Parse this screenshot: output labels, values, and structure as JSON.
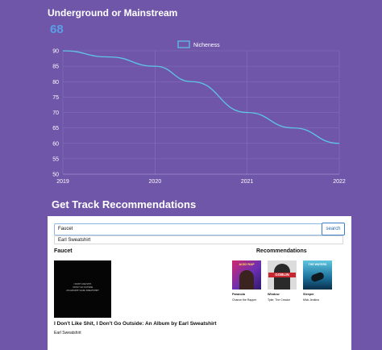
{
  "chart_section": {
    "title": "Underground or Mainstream",
    "score": "68"
  },
  "chart_data": {
    "type": "line",
    "title": "",
    "xlabel": "",
    "ylabel": "",
    "x": [
      "2019",
      "2020",
      "2021",
      "2022"
    ],
    "series": [
      {
        "name": "Nicheness",
        "x": [
          2019,
          2019.5,
          2020,
          2020.4,
          2021,
          2021.5,
          2022
        ],
        "values": [
          90,
          88,
          85,
          80,
          70,
          65,
          60
        ]
      }
    ],
    "ylim": [
      50,
      90
    ],
    "yticks": [
      "50",
      "55",
      "60",
      "65",
      "70",
      "75",
      "80",
      "85",
      "90"
    ],
    "grid": true,
    "legend": "top-center",
    "line_color": "#5ec6e6"
  },
  "recommendations_section": {
    "title": "Get Track Recommendations",
    "search_value": "Faucet",
    "search_button": "search",
    "suggestion": "Earl Sweatshirt",
    "result_heading": "Faucet",
    "album_cover_text": [
      "I DON'T LIKE SHIT,",
      "I DON'T GO OUTSIDE",
      "AN ALBUM BY EARL SWEATSHIRT"
    ],
    "album_title": "I Don't Like Shit, I Don't Go Outside: An Album by Earl Sweatshirt",
    "album_artist": "Earl Sweatshirt",
    "recommendations_heading": "Recommendations",
    "recommendations": [
      {
        "title": "Paranoia",
        "artist": "Chance the Rapper",
        "cover_text": "ACID RAP"
      },
      {
        "title": "Window",
        "artist": "Tyler, The Creator",
        "cover_text": "GOBLIN"
      },
      {
        "title": "Sleeper",
        "artist": "Mick Jenkins",
        "cover_text": "THE WATERS"
      }
    ]
  }
}
